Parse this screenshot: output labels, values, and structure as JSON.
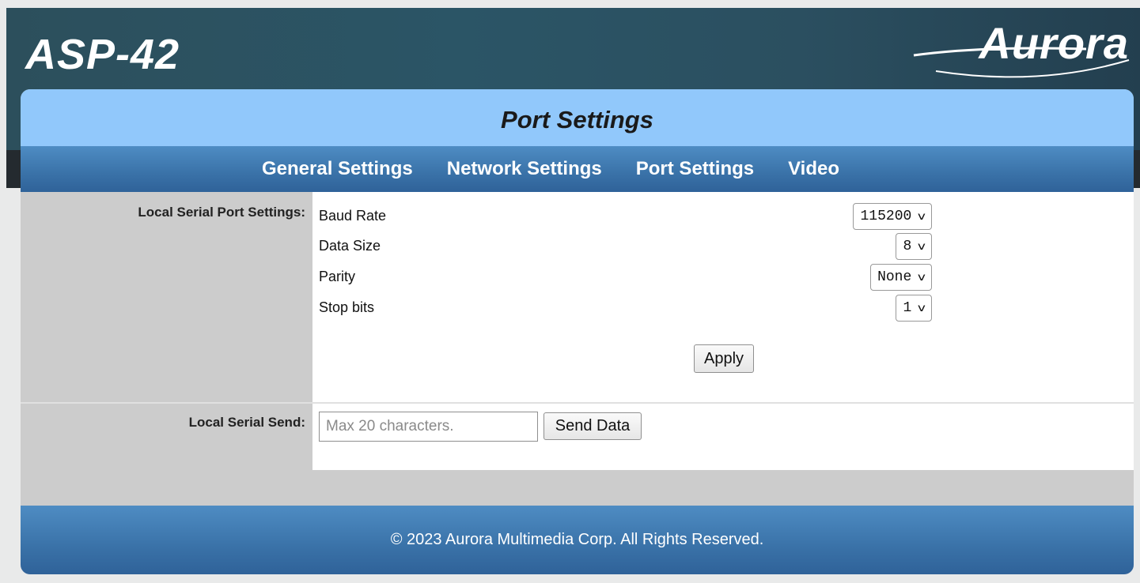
{
  "header": {
    "device_name": "ASP-42",
    "logo_text": "Aurora",
    "logo_icon": "aurora-swoosh-logo"
  },
  "page": {
    "title": "Port Settings"
  },
  "nav": {
    "items": [
      {
        "label": "General Settings"
      },
      {
        "label": "Network Settings"
      },
      {
        "label": "Port Settings"
      },
      {
        "label": "Video"
      }
    ]
  },
  "local_serial_port": {
    "section_label": "Local Serial Port Settings:",
    "baud_rate": {
      "label": "Baud Rate",
      "value": "115200"
    },
    "data_size": {
      "label": "Data Size",
      "value": "8"
    },
    "parity": {
      "label": "Parity",
      "value": "None"
    },
    "stop_bits": {
      "label": "Stop bits",
      "value": "1"
    },
    "apply_label": "Apply"
  },
  "local_serial_send": {
    "section_label": "Local Serial Send:",
    "input_value": "",
    "input_placeholder": "Max 20 characters.",
    "send_label": "Send Data"
  },
  "footer": {
    "copyright": "© 2023 Aurora Multimedia Corp. All Rights Reserved."
  },
  "colors": {
    "header_bg": "#2b5566",
    "panel_header": "#91c8fb",
    "nav_bar": "#3a72a8",
    "label_column": "#cccccc"
  }
}
